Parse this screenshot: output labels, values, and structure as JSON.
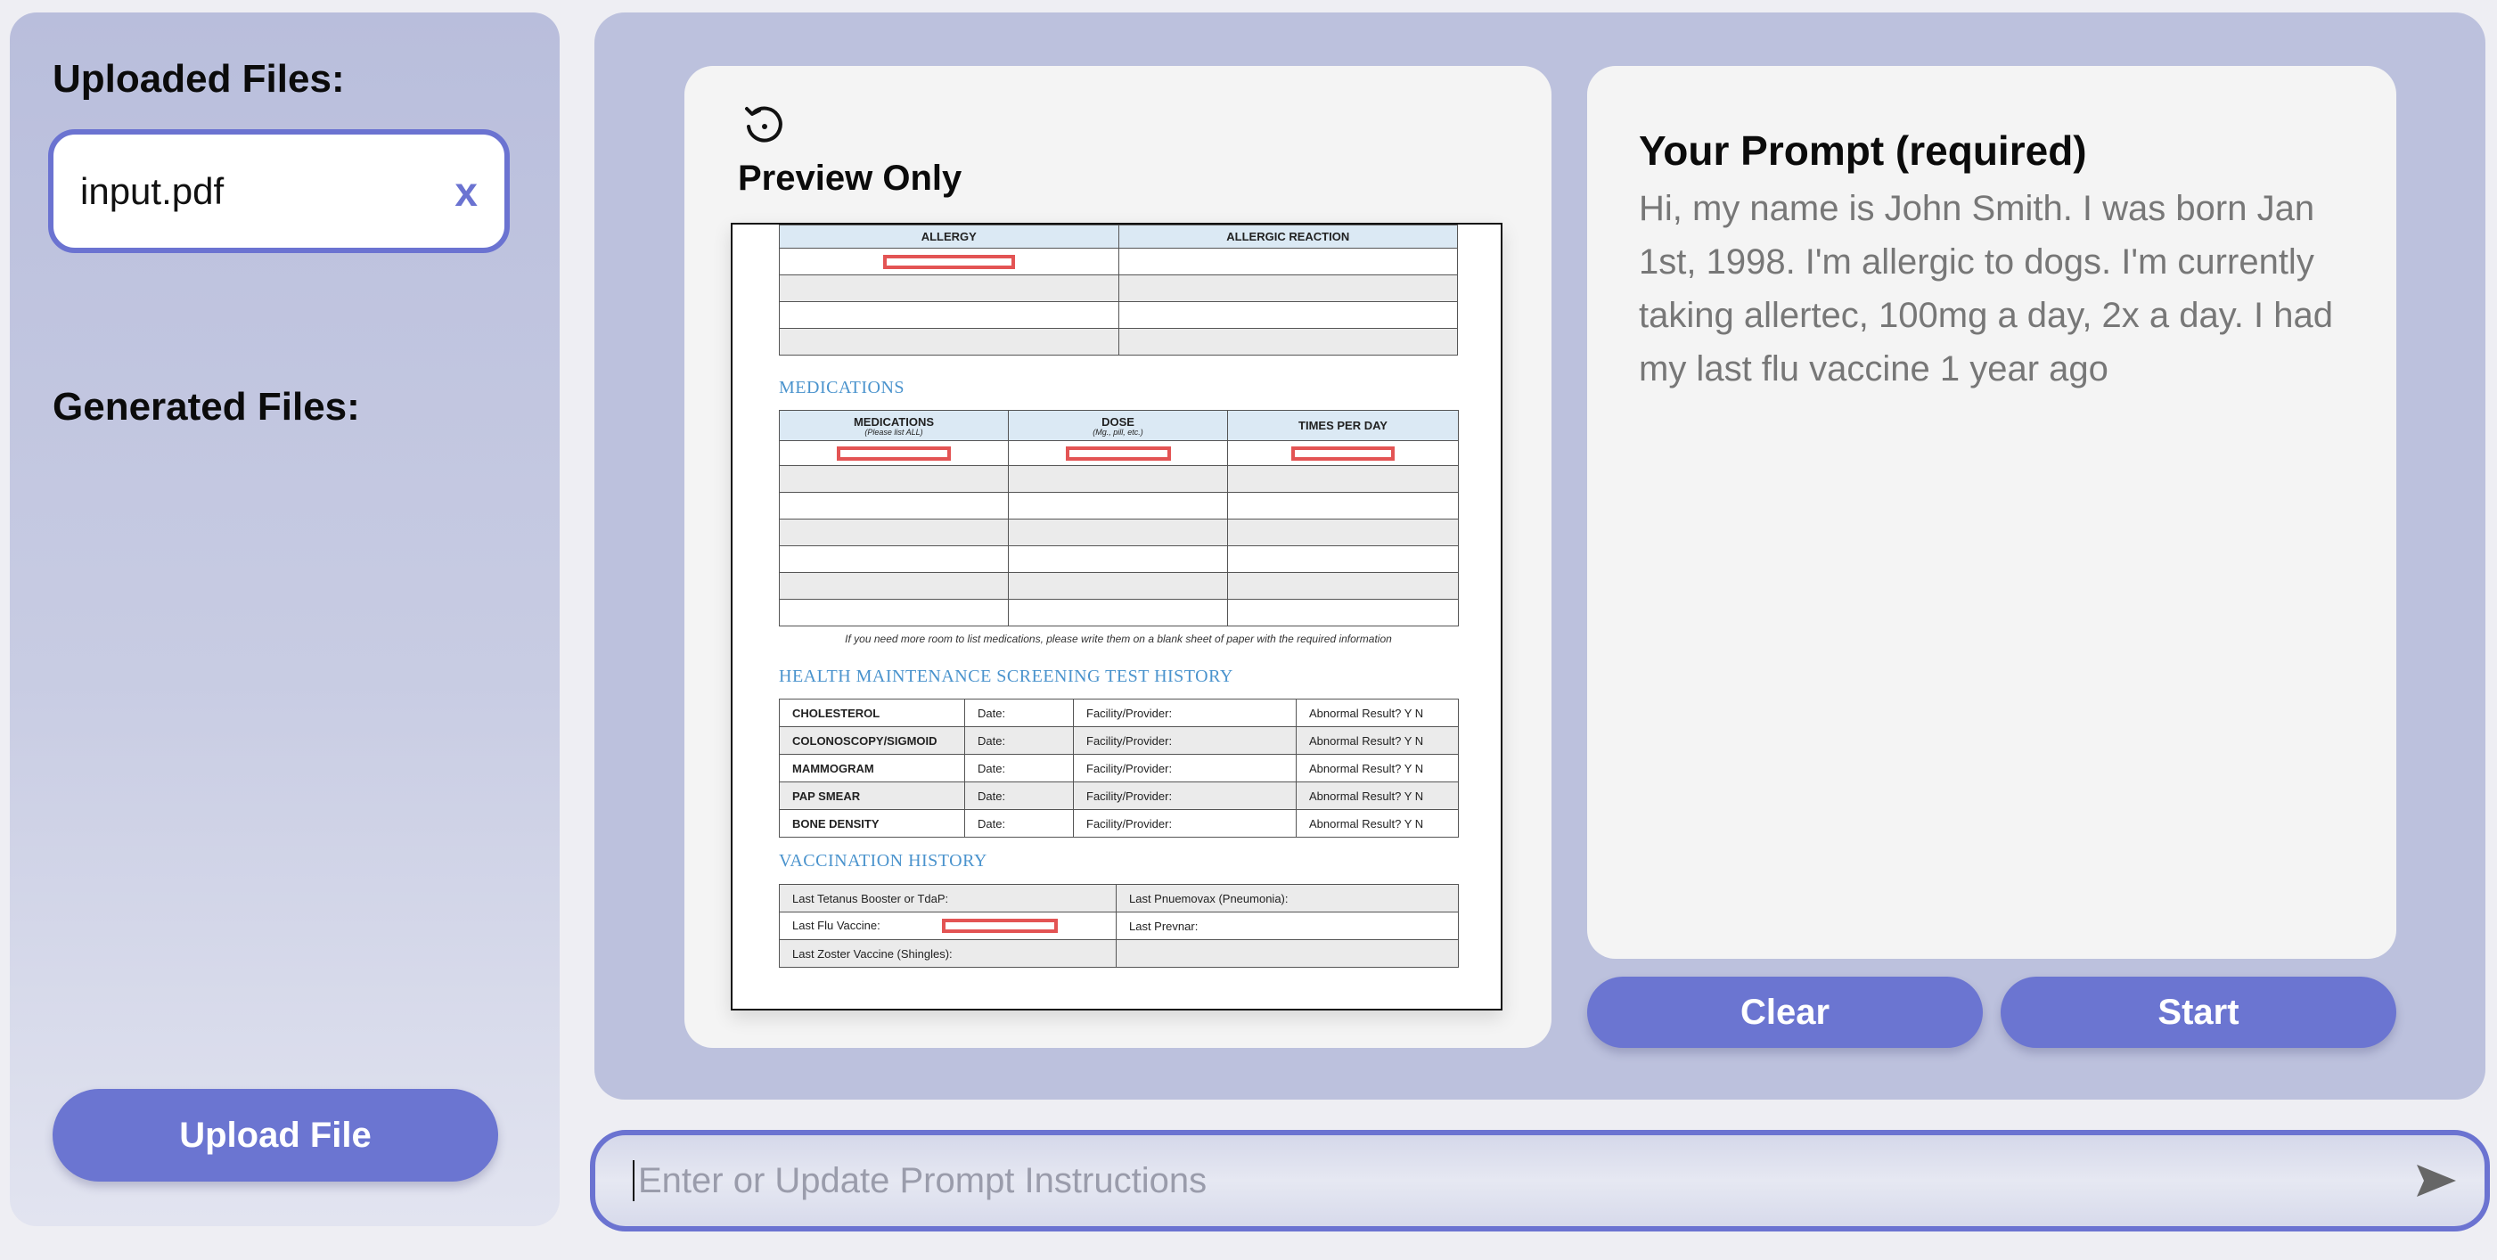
{
  "sidebar": {
    "uploaded_title": "Uploaded Files:",
    "uploaded_file": "input.pdf",
    "remove_label": "x",
    "generated_title": "Generated Files:",
    "upload_button": "Upload File"
  },
  "preview": {
    "title": "Preview Only",
    "refresh_icon": "refresh-icon",
    "document": {
      "allergy_headers": [
        "ALLERGY",
        "ALLERGIC REACTION"
      ],
      "medications_heading": "MEDICATIONS",
      "medications_headers": {
        "medications": "MEDICATIONS",
        "medications_sub": "(Please list ALL)",
        "dose": "DOSE",
        "dose_sub": "(Mg., pill, etc.)",
        "times": "TIMES PER DAY"
      },
      "medications_note": "If you need more room to list medications, please write them on a blank sheet of paper with the required information",
      "screening_heading": "HEALTH MAINTENANCE SCREENING TEST HISTORY",
      "screening_rows": [
        "CHOLESTEROL",
        "COLONOSCOPY/SIGMOID",
        "MAMMOGRAM",
        "PAP SMEAR",
        "BONE DENSITY"
      ],
      "date_label": "Date:",
      "facility_label": "Facility/Provider:",
      "abnormal_label": "Abnormal Result?   Y   N",
      "vaccination_heading": "VACCINATION HISTORY",
      "vacc_tetanus": "Last Tetanus Booster or TdaP:",
      "vacc_pneumovax": "Last Pnuemovax (Pneumonia):",
      "vacc_flu": "Last Flu Vaccine:",
      "vacc_prevnar": "Last Prevnar:",
      "vacc_zoster": "Last Zoster Vaccine (Shingles):"
    }
  },
  "prompt": {
    "title": "Your Prompt (required)",
    "text": "Hi, my name is John Smith. I was born Jan 1st, 1998. I'm allergic to dogs. I'm currently taking allertec, 100mg a day, 2x a day. I had my last flu vaccine 1 year ago",
    "clear_button": "Clear",
    "start_button": "Start"
  },
  "input_bar": {
    "placeholder": "Enter or Update Prompt Instructions",
    "send_icon": "send-icon"
  },
  "colors": {
    "accent": "#6b75d1",
    "panel": "#bcc1dd",
    "card": "#f4f4f4",
    "highlight_box": "#e35454",
    "doc_heading": "#4a93cd"
  }
}
